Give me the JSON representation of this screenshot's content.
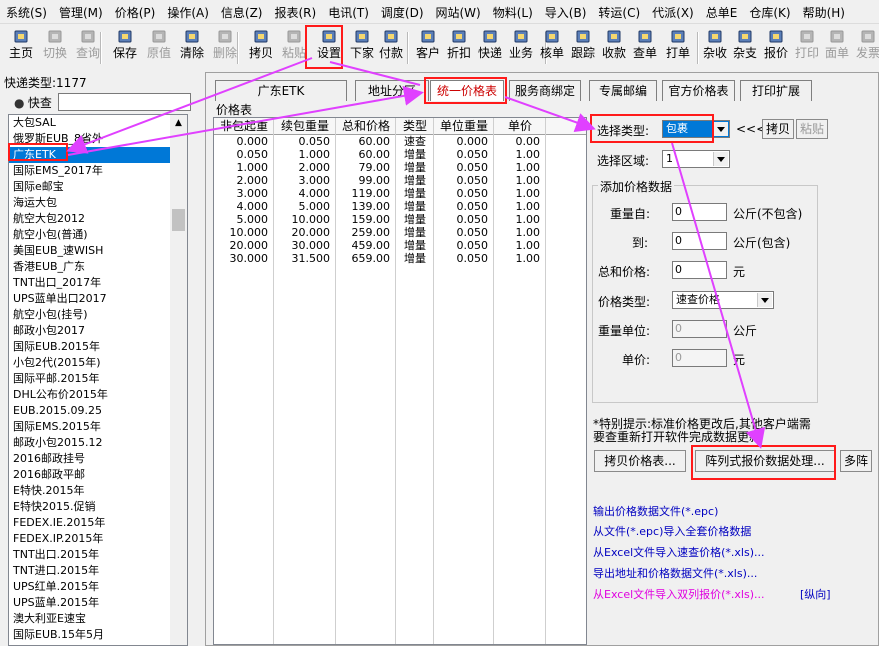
{
  "menu": [
    "系统(S)",
    "管理(M)",
    "价格(P)",
    "操作(A)",
    "信息(Z)",
    "报表(R)",
    "电讯(T)",
    "调度(D)",
    "网站(W)",
    "物料(L)",
    "导入(B)",
    "转运(C)",
    "代派(X)",
    "总单E",
    "仓库(K)",
    "帮助(H)"
  ],
  "toolbar": [
    {
      "label": "主页",
      "icon": "home-icon",
      "enabled": true
    },
    {
      "label": "切换",
      "icon": "switch-icon",
      "enabled": false
    },
    {
      "label": "查询",
      "icon": "binoculars-icon",
      "enabled": false
    },
    {
      "label": "保存",
      "icon": "save-icon",
      "enabled": true
    },
    {
      "label": "原值",
      "icon": "restore-icon",
      "enabled": false
    },
    {
      "label": "清除",
      "icon": "new-page-icon",
      "enabled": true
    },
    {
      "label": "删除",
      "icon": "delete-icon",
      "enabled": false
    },
    {
      "label": "拷贝",
      "icon": "copy-icon",
      "enabled": true
    },
    {
      "label": "粘贴",
      "icon": "paste-icon",
      "enabled": false
    },
    {
      "label": "设置",
      "icon": "settings-icon",
      "enabled": true
    },
    {
      "label": "下家",
      "icon": "next-party-icon",
      "enabled": true
    },
    {
      "label": "付款",
      "icon": "payment-icon",
      "enabled": true
    },
    {
      "label": "客户",
      "icon": "customers-icon",
      "enabled": true
    },
    {
      "label": "折扣",
      "icon": "discount-icon",
      "enabled": true
    },
    {
      "label": "快递",
      "icon": "express-icon",
      "enabled": true
    },
    {
      "label": "业务",
      "icon": "business-icon",
      "enabled": true
    },
    {
      "label": "核单",
      "icon": "verify-icon",
      "enabled": true
    },
    {
      "label": "跟踪",
      "icon": "track-icon",
      "enabled": true
    },
    {
      "label": "收款",
      "icon": "receive-icon",
      "enabled": true
    },
    {
      "label": "查单",
      "icon": "search-order-icon",
      "enabled": true
    },
    {
      "label": "打单",
      "icon": "print-order-icon",
      "enabled": true
    },
    {
      "label": "杂收",
      "icon": "misc-income-icon",
      "enabled": true
    },
    {
      "label": "杂支",
      "icon": "misc-expense-icon",
      "enabled": true
    },
    {
      "label": "报价",
      "icon": "quote-icon",
      "enabled": true
    },
    {
      "label": "打印",
      "icon": "print-icon",
      "enabled": false
    },
    {
      "label": "面单",
      "icon": "waybill-icon",
      "enabled": false
    },
    {
      "label": "发票",
      "icon": "invoice-icon",
      "enabled": false
    }
  ],
  "left": {
    "count_label": "快递类型:1177",
    "search_label": "快查",
    "search_value": "",
    "items": [
      "大包SAL",
      "俄罗斯EUB_8省外",
      "广东ETK",
      "国际EMS_2017年",
      "国际e邮宝",
      "海运大包",
      "航空大包2012",
      "航空小包(普通)",
      "美国EUB_速WISH",
      "香港EUB_广东",
      "TNT出口_2017年",
      "UPS蓝单出口2017",
      "航空小包(挂号)",
      "邮政小包2017",
      "国际EUB.2015年",
      "小包2代(2015年)",
      "国际平邮.2015年",
      "DHL公布价2015年",
      "EUB.2015.09.25",
      "国际EMS.2015年",
      "邮政小包2015.12",
      "2016邮政挂号",
      "2016邮政平邮",
      "E特快.2015年",
      "E特快2015.促销",
      "FEDEX.IE.2015年",
      "FEDEX.IP.2015年",
      "TNT出口.2015年",
      "TNT进口.2015年",
      "UPS红单.2015年",
      "UPS蓝单.2015年",
      "澳大利亚E速宝",
      "国际EUB.15年5月"
    ],
    "selected": "广东ETK"
  },
  "tabs": [
    "广东ETK",
    "地址分区",
    "统一价格表",
    "服务商绑定",
    "专属邮编",
    "官方价格表",
    "打印扩展"
  ],
  "active_tab": "统一价格表",
  "price_table": {
    "caption": "价格表",
    "headers": [
      "非包起重",
      "续包重量",
      "总和价格",
      "类型",
      "单位重量",
      "单价"
    ],
    "rows": [
      [
        "0.000",
        "0.050",
        "60.00",
        "速查",
        "0.000",
        "0.00"
      ],
      [
        "0.050",
        "1.000",
        "60.00",
        "增量",
        "0.050",
        "1.00"
      ],
      [
        "1.000",
        "2.000",
        "79.00",
        "增量",
        "0.050",
        "1.00"
      ],
      [
        "2.000",
        "3.000",
        "99.00",
        "增量",
        "0.050",
        "1.00"
      ],
      [
        "3.000",
        "4.000",
        "119.00",
        "增量",
        "0.050",
        "1.00"
      ],
      [
        "4.000",
        "5.000",
        "139.00",
        "增量",
        "0.050",
        "1.00"
      ],
      [
        "5.000",
        "10.000",
        "159.00",
        "增量",
        "0.050",
        "1.00"
      ],
      [
        "10.000",
        "20.000",
        "259.00",
        "增量",
        "0.050",
        "1.00"
      ],
      [
        "20.000",
        "30.000",
        "459.00",
        "增量",
        "0.050",
        "1.00"
      ],
      [
        "30.000",
        "31.500",
        "659.00",
        "增量",
        "0.050",
        "1.00"
      ]
    ]
  },
  "right": {
    "select_type_label": "选择类型:",
    "select_type_value": "包裹",
    "arrows": "<<<",
    "copy_button": "拷贝",
    "paste_button": "粘贴",
    "select_zone_label": "选择区域:",
    "select_zone_value": "1",
    "add_group_title": "添加价格数据",
    "weight_from_label": "重量自:",
    "weight_from_value": "0",
    "weight_from_unit": "公斤(不包含)",
    "weight_to_label": "到:",
    "weight_to_value": "0",
    "weight_to_unit": "公斤(包含)",
    "total_price_label": "总和价格:",
    "total_price_value": "0",
    "total_price_unit": "元",
    "price_type_label": "价格类型:",
    "price_type_value": "速查价格",
    "unit_weight_label": "重量单位:",
    "unit_weight_value": "0",
    "unit_weight_unit": "公斤",
    "unit_price_label": "单价:",
    "unit_price_value": "0",
    "unit_price_unit": "元",
    "tip_line1": "*特别提示:标准价格更改后,其他客户端需",
    "tip_line2": "要查重新打开软件完成数据更新",
    "copy_table_button": "拷贝价格表...",
    "array_button": "阵列式报价数据处理...",
    "multi_button": "多阵",
    "links": [
      {
        "text": "输出价格数据文件(*.epc)",
        "color": "#0000c0"
      },
      {
        "text": "从文件(*.epc)导入全套价格数据",
        "color": "#0000c0"
      },
      {
        "text": "从Excel文件导入速查价格(*.xls)...",
        "color": "#0000c0"
      },
      {
        "text": "导出地址和价格数据文件(*.xls)...",
        "color": "#0000c0"
      },
      {
        "text": "从Excel文件导入双列报价(*.xls)...",
        "color": "#e000e0"
      }
    ],
    "vertical_link": "[纵向]"
  },
  "colors": {
    "highlight": "#ff1a1a",
    "arrow": "#e040ff",
    "selection": "#0078d7"
  }
}
